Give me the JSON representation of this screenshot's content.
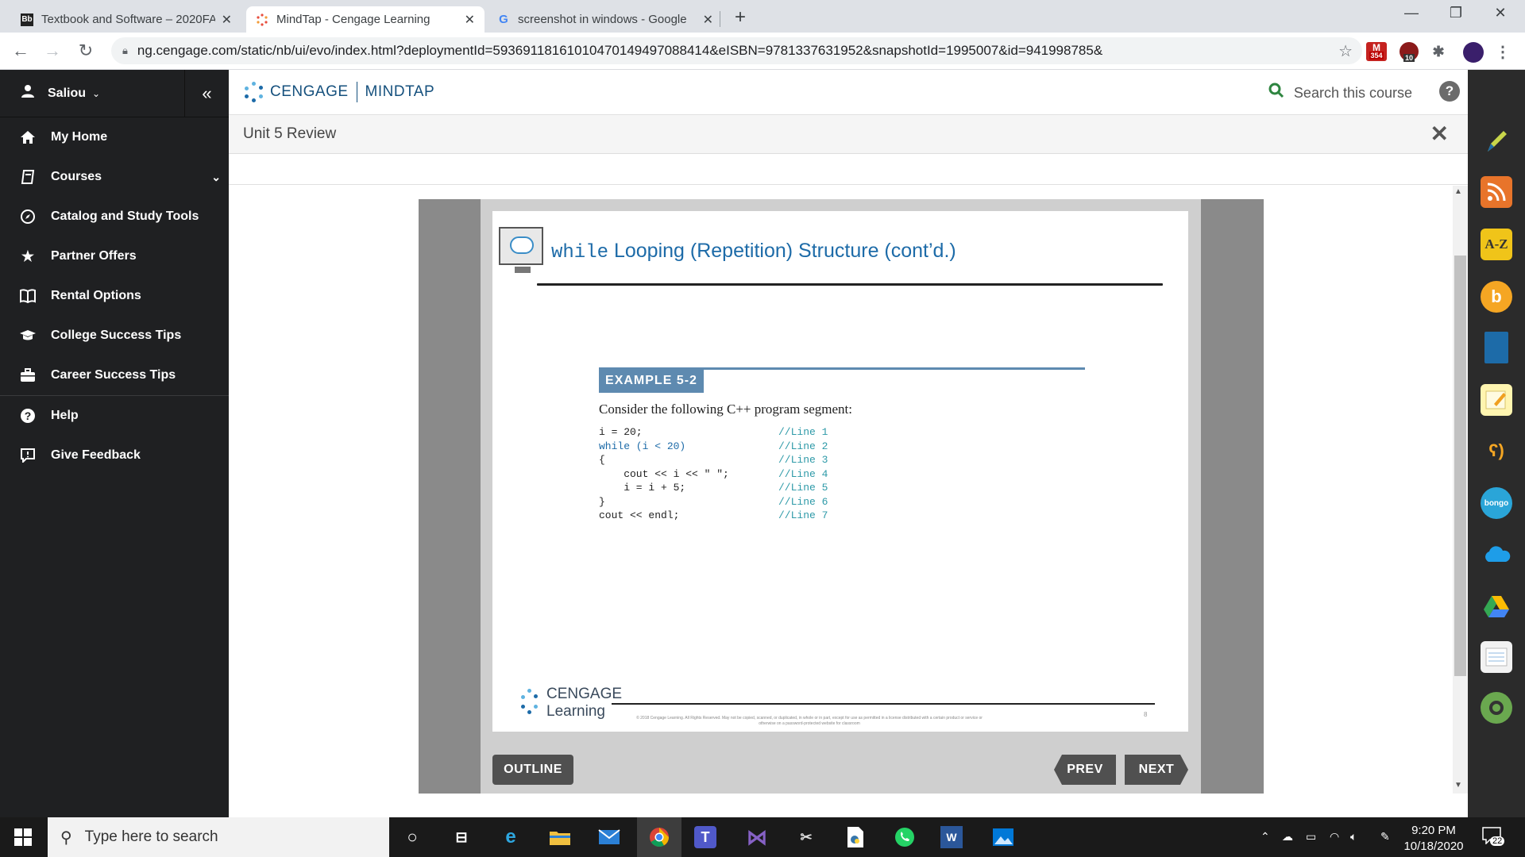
{
  "browser": {
    "tabs": [
      {
        "label": "Textbook and Software – 2020FA",
        "favicon": "Bb"
      },
      {
        "label": "MindTap - Cengage Learning",
        "favicon": "cengage-dots"
      },
      {
        "label": "screenshot in windows - Google",
        "favicon": "G"
      }
    ],
    "url": "ng.cengage.com/static/nb/ui/evo/index.html?deploymentId=5936911816101047014949708841​4&eISBN=9781337631952&snapshotId=1995007&id=941998785&",
    "extensions": {
      "mail_badge": "354",
      "ext2_badge": "10"
    }
  },
  "sidebar": {
    "user": "Saliou",
    "items": [
      {
        "label": "My Home",
        "icon": "home-icon"
      },
      {
        "label": "Courses",
        "icon": "book-icon"
      },
      {
        "label": "Catalog and Study Tools",
        "icon": "compass-icon"
      },
      {
        "label": "Partner Offers",
        "icon": "star-icon"
      },
      {
        "label": "Rental Options",
        "icon": "rental-book-icon"
      },
      {
        "label": "College Success Tips",
        "icon": "graduation-cap-icon"
      },
      {
        "label": "Career Success Tips",
        "icon": "briefcase-icon"
      },
      {
        "label": "Help",
        "icon": "help-icon"
      },
      {
        "label": "Give Feedback",
        "icon": "feedback-icon"
      }
    ]
  },
  "header": {
    "brand_left": "CENGAGE",
    "brand_right": "MINDTAP",
    "search_label": "Search this course"
  },
  "page": {
    "title": "Unit 5 Review"
  },
  "slide": {
    "title_code": "while",
    "title_text": " Looping (Repetition) Structure (cont’d.)",
    "example_label": "EXAMPLE 5-2",
    "example_desc": "Consider the following C++ program segment:",
    "code_lines": [
      "i = 20;",
      "while (i < 20)",
      "{",
      "    cout << i << \" \";",
      "    i = i + 5;",
      "}",
      "cout << endl;"
    ],
    "comments": [
      "//Line 1",
      "//Line 2",
      "//Line 3",
      "//Line 4",
      "//Line 5",
      "//Line 6",
      "//Line 7"
    ],
    "footer_logo_top": "CENGAGE",
    "footer_logo_bottom": "Learning",
    "fine_print": "© 2018 Cengage Learning. All Rights Reserved. May not be copied, scanned, or duplicated, in whole or in part, except for use as permitted in a license distributed with a certain product or service or otherwise on a password-protected website for classroom",
    "page_number": "8"
  },
  "controls": {
    "outline": "OUTLINE",
    "prev": "PREV",
    "next": "NEXT"
  },
  "taskbar": {
    "search_placeholder": "Type here to search",
    "time": "9:20 PM",
    "date": "10/18/2020",
    "notifications": "22"
  },
  "colors": {
    "sidebar_bg": "#1f2022",
    "brand_blue": "#15507d",
    "example_blue": "#5e8ab0",
    "button_gray": "#505050"
  }
}
